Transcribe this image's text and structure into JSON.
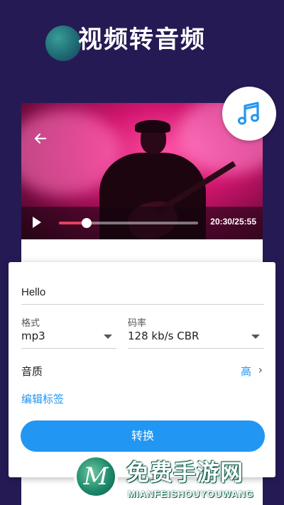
{
  "header": {
    "title": "视频转音频"
  },
  "player": {
    "time_display": "20:30/25:55",
    "progress": 0.2
  },
  "form": {
    "title_value": "Hello",
    "format_label": "格式",
    "format_value": "mp3",
    "bitrate_label": "码率",
    "bitrate_value": "128 kb/s CBR",
    "quality_label": "音质",
    "quality_value": "高",
    "edit_tags_label": "编辑标签",
    "convert_button": "转换"
  },
  "watermark": {
    "logo_letter": "M",
    "title": "免费手游网",
    "subtitle": "MIANFEISHOUYOUWANG"
  },
  "colors": {
    "background": "#261a55",
    "accent": "#2196f3",
    "progress_fill": "#e83e63"
  },
  "icons": {
    "back": "arrow-left-icon",
    "play": "play-icon",
    "music": "music-note-icon",
    "chevron": "chevron-right-icon",
    "dropdown": "caret-down-icon"
  }
}
